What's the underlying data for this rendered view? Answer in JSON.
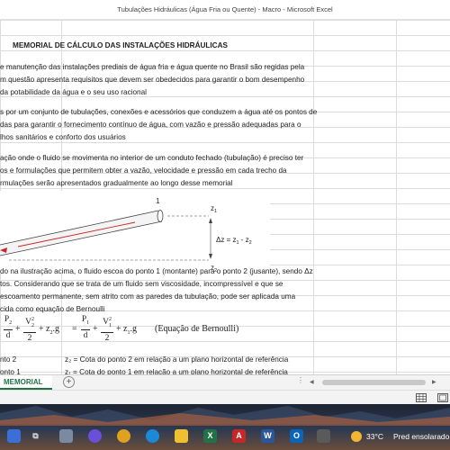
{
  "window": {
    "title": "Tubulações Hidráulicas (Água Fria ou Quente) - Macro - Microsoft Excel"
  },
  "sheet": {
    "heading": "MEMORIAL DE CÁLCULO DAS INSTALAÇÕES HIDRÁULICAS",
    "paragraph1": [
      "e manutenção das instalações prediais de água fria e água quente no Brasil são regidas pela",
      "m questão apresenta requisitos que devem ser obedecidos para garantir o bom desempenho",
      "da potabilidade da água e o seu uso racional"
    ],
    "paragraph2": [
      "s por um conjunto de tubulações, conexões e acessórios que conduzem a água até os pontos de",
      "das para garantir o fornecimento contínuo de água, com vazão e pressão adequadas para o",
      "lhos sanitários e conforto dos usuários"
    ],
    "paragraph3": [
      "ação onde o fluido se movimenta no interior de um conduto fechado (tubulação) é preciso ter",
      "os e formulações que permitem obter a vazão, velocidade e pressão em cada trecho da",
      "rmulações serão apresentados gradualmente ao longo desse memorial"
    ],
    "diagram": {
      "point1_label": "1",
      "z1_label": "z",
      "z1_sub": "1",
      "z2_label": "z",
      "z2_sub": "2",
      "dz_text": "Δz = z",
      "dz_sub1": "1",
      "dz_mid": " - z",
      "dz_sub2": "2"
    },
    "paragraph4": [
      "do na ilustração acima, o fluido escoa do ponto 1 (montante) para o ponto 2 (jusante), sendo Δz",
      "tos. Considerando que se trata de um fluido sem viscosidade, incompressível e que se",
      "escoamento permanente, sem atrito com as paredes da tubulação, pode ser aplicada uma",
      "cida como equação de Bernoulli"
    ],
    "equation": {
      "p2": "P",
      "p2_sub": "2",
      "d": "d",
      "v2": "V",
      "v2_sub": "2",
      "sq": "2",
      "two": "2",
      "z2": "z",
      "z2_sub": "2",
      "p1": "P",
      "p1_sub": "1",
      "v1": "V",
      "v1_sub": "1",
      "z1": "z",
      "z1_sub": "1",
      "g": "g",
      "plus": "+",
      "eq": "=",
      "dot": ".",
      "label": "(Equação de Bernoulli)"
    },
    "row_a_left": "nto 2",
    "row_a_right": "z₂ = Cota do ponto 2 em relação a um plano horizontal de referência",
    "row_b_left": "onto 1",
    "row_b_right": "z₁ = Cota do ponto 1 em relação a um plano horizontal de referência"
  },
  "tabs": {
    "active": "MEMORIAL",
    "add_label": "+"
  },
  "hscroll": {
    "dots": "⋮",
    "left_arrow": "◀",
    "right_arrow": "▶"
  },
  "taskbar": {
    "excel_label": "X",
    "pdf_label": "A",
    "word_label": "W",
    "outlook_label": "O",
    "temperature": "33°C",
    "weather_desc": "Pred ensolarado"
  },
  "colors": {
    "excel_green": "#217346",
    "sheet_grid": "#dcdcdc",
    "arrow_red": "#c62828"
  }
}
